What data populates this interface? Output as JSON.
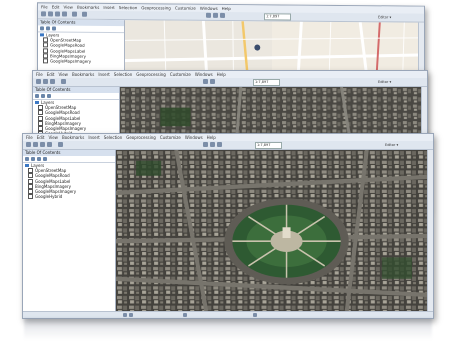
{
  "menu": [
    "File",
    "Edit",
    "View",
    "Bookmarks",
    "Insert",
    "Selection",
    "Geoprocessing",
    "Customize",
    "Windows",
    "Help"
  ],
  "toolbar": {
    "scale": "1:7,897",
    "editor": "Editor ▾"
  },
  "toc": {
    "title": "Table Of Contents",
    "group": "Layers",
    "layers": [
      "OpenStreetMap",
      "GoogleMapsRoad",
      "GoogleMapsLabel",
      "BingMapsImagery",
      "GoogleMapsImagery",
      "GoogleHybrid"
    ]
  },
  "colors": {
    "accent": "#3b78c4",
    "road_map_bg": "#e8e4dc",
    "imagery_dark": "#3a3a36",
    "park_green": "#2f6f3a"
  }
}
